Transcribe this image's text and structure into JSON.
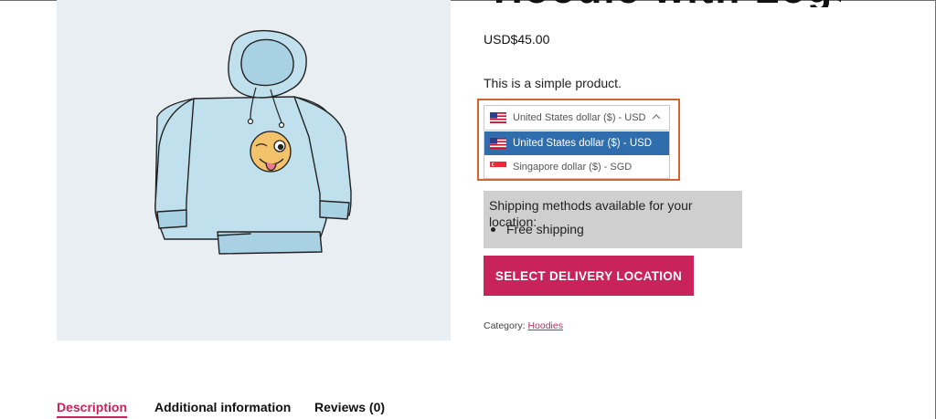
{
  "product": {
    "title": "Hoodie with Logo",
    "price": "USD$45.00",
    "description": "This is a simple product."
  },
  "currency_switcher": {
    "selected": "United States dollar ($) - USD",
    "options": [
      {
        "label": "United States dollar ($) - USD",
        "flag": "us-flag-icon",
        "highlighted": true
      },
      {
        "label": "Singapore dollar ($) - SGD",
        "flag": "sg-flag-icon",
        "highlighted": false
      }
    ]
  },
  "shipping": {
    "title": "Shipping methods available for your location:",
    "methods": [
      "Free shipping"
    ]
  },
  "delivery_button": {
    "label": "SELECT DELIVERY LOCATION"
  },
  "category": {
    "label": "Category:",
    "value": "Hoodies"
  },
  "tabs": [
    {
      "label": "Description",
      "active": true
    },
    {
      "label": "Additional information",
      "active": false
    },
    {
      "label": "Reviews (0)",
      "active": false
    }
  ],
  "colors": {
    "accent": "#c8235a",
    "highlight_border": "#d1642f",
    "dropdown_selected": "#2f6dac",
    "shipping_box": "#cfcfcf",
    "image_bg": "#e8eef2"
  }
}
